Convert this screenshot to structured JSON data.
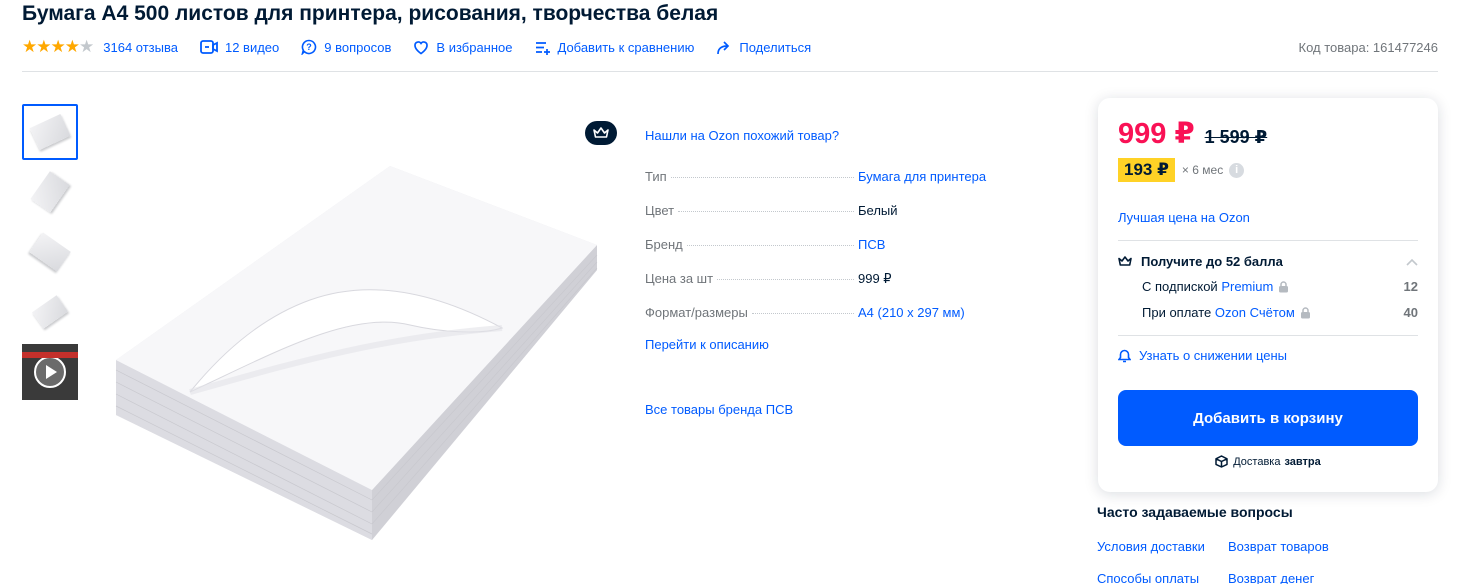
{
  "product": {
    "title": "Бумага А4 500 листов для принтера, рисования, творчества белая",
    "rating": 4,
    "sku_text": "Код товара: 161477246"
  },
  "meta": {
    "reviews": "3164 отзыва",
    "videos": "12 видео",
    "questions": "9 вопросов",
    "favorite": "В избранное",
    "compare": "Добавить к сравнению",
    "share": "Поделиться"
  },
  "specs": {
    "similar_link": "Нашли на Ozon похожий товар?",
    "rows": [
      {
        "key": "Тип",
        "value": "Бумага для принтера"
      },
      {
        "key": "Цвет",
        "value": "Белый"
      },
      {
        "key": "Бренд",
        "value": "ПСВ"
      },
      {
        "key": "Цена за шт",
        "value": "999 ₽"
      },
      {
        "key": "Формат/размеры",
        "value": "А4 (210 x 297 мм)"
      }
    ],
    "to_description": "Перейти к описанию",
    "brand_all": "Все товары бренда ПСВ"
  },
  "buy_card": {
    "price": "999 ₽",
    "old_price": "1 599 ₽",
    "installment_amount": "193 ₽",
    "installment_term": "× 6 мес",
    "info_icon": "i",
    "best_price": "Лучшая цена на Ozon",
    "bonus_title": "Получите до 52 балла",
    "bonus_sub_prefix": "С подпиской",
    "bonus_sub_link": "Premium",
    "bonus_sub_points": "12",
    "bonus_pay_prefix": "При оплате",
    "bonus_pay_link": "Ozon Счётом",
    "bonus_pay_points": "40",
    "notify": "Узнать о снижении цены",
    "add_to_cart": "Добавить в корзину",
    "delivery_label": "Доставка",
    "delivery_when": "завтра"
  },
  "faq": {
    "title": "Часто задаваемые вопросы",
    "links": [
      "Условия доставки",
      "Возврат товаров",
      "Способы оплаты",
      "Возврат денег"
    ]
  },
  "colors": {
    "accent": "#005bff",
    "price": "#f91155",
    "star": "#ffa800",
    "installment_chip": "#ffd226",
    "text": "#001a34",
    "muted": "#70757a"
  }
}
